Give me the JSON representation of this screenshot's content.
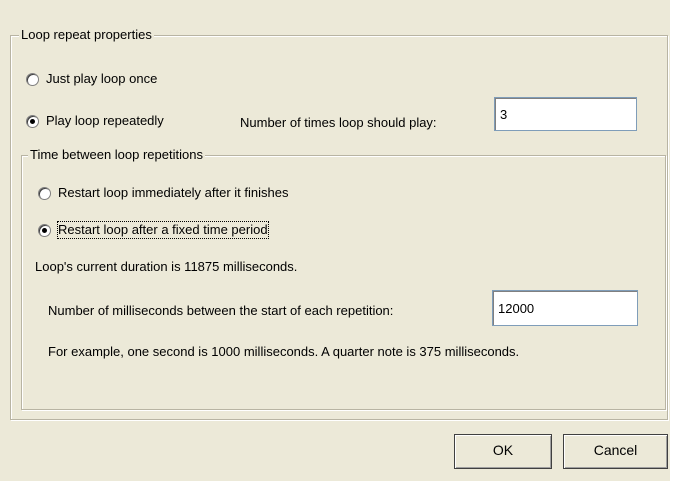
{
  "dialog": {
    "loop_group_title": "Loop repeat properties",
    "play_once_label": "Just play loop once",
    "play_repeat_label": "Play loop repeatedly",
    "repeat_count_label": "Number of times loop should play:",
    "repeat_count_value": "3",
    "play_mode_selected": "repeatedly",
    "time_group_title": "Time between loop repetitions",
    "restart_immediate_label": "Restart loop immediately after it finishes",
    "restart_fixed_label": "Restart loop after a fixed time period",
    "restart_mode_selected": "fixed",
    "duration_text": "Loop's current duration is 11875 milliseconds.",
    "ms_between_label": "Number of milliseconds between the start of each repetition:",
    "ms_between_value": "12000",
    "example_text": "For example, one second is 1000 milliseconds.  A quarter note is 375 milliseconds.",
    "ok_label": "OK",
    "cancel_label": "Cancel"
  }
}
